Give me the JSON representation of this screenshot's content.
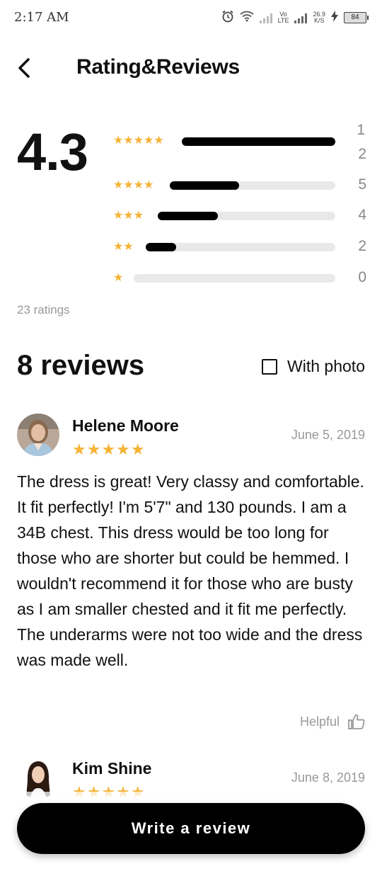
{
  "status_bar": {
    "time": "2:17 AM",
    "net_label_top": "Vo",
    "net_label_bottom": "LTE",
    "speed_value": "26.9",
    "speed_unit": "K/S",
    "battery": "84"
  },
  "header": {
    "title": "Rating&Reviews"
  },
  "summary": {
    "average": "4.3",
    "total_label": "23 ratings",
    "distribution": [
      {
        "stars": 5,
        "count_top": "1",
        "count": "2",
        "fraction": 1.0
      },
      {
        "stars": 4,
        "count": "5",
        "fraction": 0.42
      },
      {
        "stars": 3,
        "count": "4",
        "fraction": 0.34
      },
      {
        "stars": 2,
        "count": "2",
        "fraction": 0.16
      },
      {
        "stars": 1,
        "count": "0",
        "fraction": 0.0
      }
    ]
  },
  "reviews_section": {
    "title": "8 reviews",
    "filter_label": "With photo",
    "filter_checked": false
  },
  "reviews": [
    {
      "name": "Helene Moore",
      "date": "June 5, 2019",
      "rating": 5,
      "text": "The dress is great! Very classy and comfortable. It fit perfectly! I'm 5'7\" and 130 pounds. I am a 34B chest. This dress would be too long for those who are shorter but could be hemmed. I wouldn't recommend it for those who are busty as I am smaller chested and it fit me perfectly. The underarms were not too wide and the dress was made well.",
      "helpful_label": "Helpful"
    },
    {
      "name": "Kim Shine",
      "date": "June 8, 2019",
      "rating": 5
    }
  ],
  "actions": {
    "write_review": "Write a review"
  },
  "colors": {
    "star": "#f5b335",
    "bar_fill": "#000000",
    "bar_track": "#e9e9e9",
    "muted_text": "#999999"
  }
}
